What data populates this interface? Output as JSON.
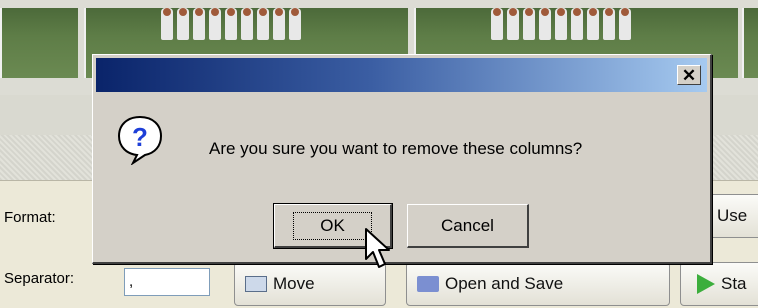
{
  "background": {
    "format_label": "Format:",
    "separator_label": "Separator:",
    "separator_value": ",",
    "buttons": {
      "use": "Use",
      "move": "Move",
      "open_and_save": "Open and Save",
      "start": "Sta"
    }
  },
  "dialog": {
    "title": "",
    "close_glyph": "✕",
    "icon": "question-icon",
    "message": "Are you sure you want to remove these columns?",
    "ok_label": "OK",
    "cancel_label": "Cancel"
  },
  "colors": {
    "titlebar_start": "#0a246a",
    "titlebar_end": "#a6caf0",
    "dialog_face": "#d4d0c8",
    "question_blue": "#1e3fd8"
  }
}
